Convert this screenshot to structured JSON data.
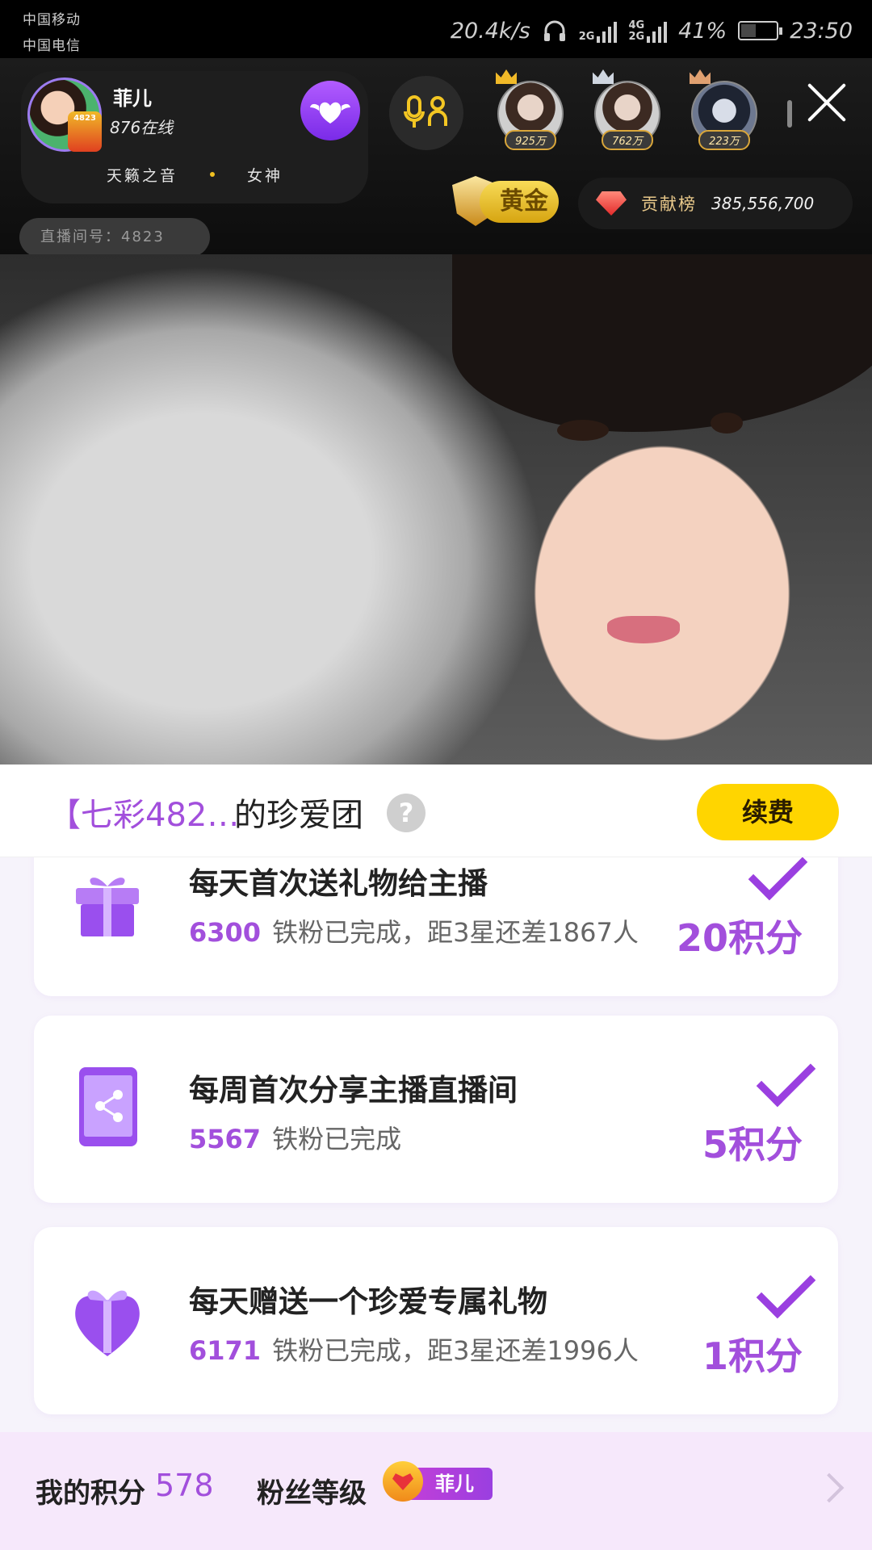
{
  "status_bar": {
    "carrier1": "中国移动",
    "carrier2": "中国电信",
    "speed": "20.4k/s",
    "network_top": "2G",
    "network2": "4G",
    "network2_sub": "2G",
    "battery": "41%",
    "time": "23:50",
    "icons": [
      "headphone-icon",
      "signal-icon",
      "battery-icon"
    ]
  },
  "live_header": {
    "host_name": "菲儿",
    "online": "876在线",
    "host_badge": "4823",
    "tags": [
      "天籁之音",
      "女神"
    ],
    "fans": [
      {
        "value": "925万",
        "crown_color": "#f0b928"
      },
      {
        "value": "762万",
        "crown_color": "#cfd6e0"
      },
      {
        "value": "223万",
        "crown_color": "#e0a070"
      }
    ],
    "gold_label": "黄金",
    "contribution_label": "贡献榜",
    "contribution_value": "385,556,700",
    "room_number": "直播间号：4823"
  },
  "group": {
    "name": "【七彩482…",
    "suffix": "的珍爱团",
    "help": "?",
    "renew_label": "续费"
  },
  "tasks": [
    {
      "icon": "gift-icon",
      "title": "每天首次送礼物给主播",
      "count": "6300",
      "status": "铁粉已完成，距3星还差1867人",
      "points": "20积分",
      "completed": true
    },
    {
      "icon": "phone-share-icon",
      "title": "每周首次分享主播直播间",
      "count": "5567",
      "status": "铁粉已完成",
      "points": "5积分",
      "completed": true
    },
    {
      "icon": "heart-gift-icon",
      "title": "每天赠送一个珍爱专属礼物",
      "count": "6171",
      "status": "铁粉已完成，距3星还差1996人",
      "points": "1积分",
      "completed": true
    }
  ],
  "bottom": {
    "my_points_label": "我的积分",
    "my_points_value": "578",
    "fan_level_label": "粉丝等级",
    "fan_level_name": "菲儿"
  },
  "colors": {
    "accent": "#a24fdc",
    "renew": "#ffd500",
    "bottom_bg": "#f6e8fb"
  }
}
